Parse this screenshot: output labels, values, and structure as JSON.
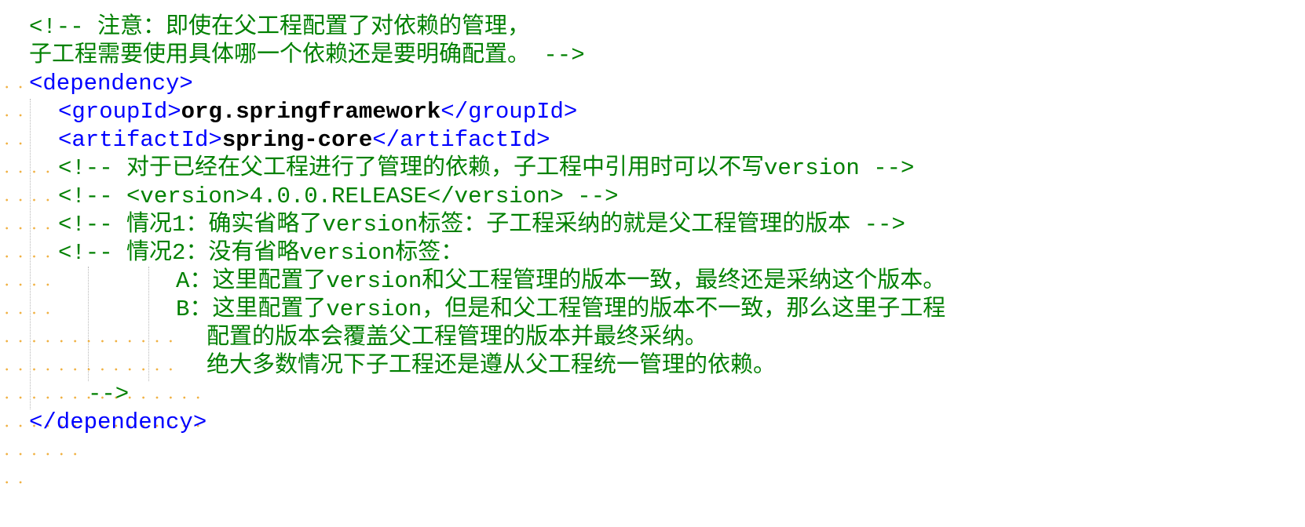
{
  "colors": {
    "comment": "#008000",
    "tag": "#0000ff",
    "value": "#000000",
    "whitespace_marker": "#f0b040"
  },
  "code": {
    "line1": "<!-- 注意：即使在父工程配置了对依赖的管理，",
    "line2": "子工程需要使用具体哪一个依赖还是要明确配置。 -->",
    "line3": "<dependency>",
    "line4_open": "<groupId>",
    "line4_value": "org.springframework",
    "line4_close": "</groupId>",
    "line5_open": "<artifactId>",
    "line5_value": "spring-core",
    "line5_close": "</artifactId>",
    "line6": "<!-- 对于已经在父工程进行了管理的依赖，子工程中引用时可以不写version -->",
    "line7": "<!-- <version>4.0.0.RELEASE</version> -->",
    "line8": "<!-- 情况1：确实省略了version标签：子工程采纳的就是父工程管理的版本 -->",
    "line9": "<!-- 情况2：没有省略version标签：",
    "line10": "A：这里配置了version和父工程管理的版本一致，最终还是采纳这个版本。",
    "line11": "B：这里配置了version，但是和父工程管理的版本不一致，那么这里子工程",
    "line12": "配置的版本会覆盖父工程管理的版本并最终采纳。",
    "line13": "绝大多数情况下子工程还是遵从父工程统一管理的依赖。",
    "line14": "-->",
    "line15": "</dependency>"
  }
}
